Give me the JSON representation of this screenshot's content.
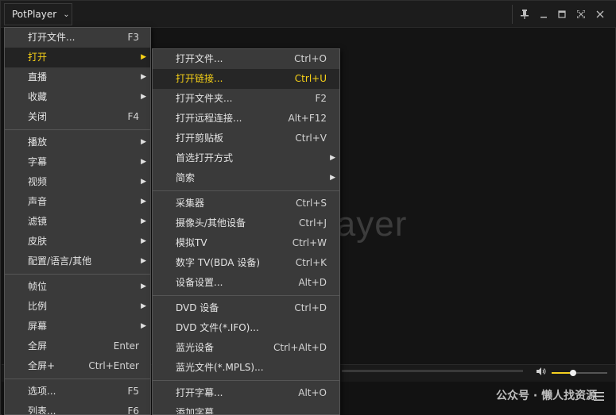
{
  "titlebar": {
    "app_name": "PotPlayer",
    "chevron_icon": "chevron-down-icon",
    "controls": [
      "pin-icon",
      "minimize-icon",
      "maximize-icon",
      "fullscreen-icon",
      "close-icon"
    ]
  },
  "video": {
    "logo_text": "layer"
  },
  "bottom": {
    "volume_level": 0.38,
    "watermark": "公众号 · 懒人找资源"
  },
  "main_menu": {
    "items": [
      {
        "label": "打开文件...",
        "shortcut": "F3",
        "submenu": false
      },
      {
        "label": "打开",
        "shortcut": "",
        "submenu": true,
        "active": true
      },
      {
        "label": "直播",
        "shortcut": "",
        "submenu": true
      },
      {
        "label": "收藏",
        "shortcut": "",
        "submenu": true
      },
      {
        "label": "关闭",
        "shortcut": "F4",
        "submenu": false
      },
      {
        "separator": true
      },
      {
        "label": "播放",
        "shortcut": "",
        "submenu": true
      },
      {
        "label": "字幕",
        "shortcut": "",
        "submenu": true
      },
      {
        "label": "视频",
        "shortcut": "",
        "submenu": true
      },
      {
        "label": "声音",
        "shortcut": "",
        "submenu": true
      },
      {
        "label": "滤镜",
        "shortcut": "",
        "submenu": true
      },
      {
        "label": "皮肤",
        "shortcut": "",
        "submenu": true
      },
      {
        "label": "配置/语言/其他",
        "shortcut": "",
        "submenu": true
      },
      {
        "separator": true
      },
      {
        "label": "帧位",
        "shortcut": "",
        "submenu": true
      },
      {
        "label": "比例",
        "shortcut": "",
        "submenu": true
      },
      {
        "label": "屏幕",
        "shortcut": "",
        "submenu": true
      },
      {
        "label": "全屏",
        "shortcut": "Enter",
        "submenu": false
      },
      {
        "label": "全屏+",
        "shortcut": "Ctrl+Enter",
        "submenu": false
      },
      {
        "separator": true
      },
      {
        "label": "选项...",
        "shortcut": "F5",
        "submenu": false
      },
      {
        "label": "列表...",
        "shortcut": "F6",
        "submenu": false
      }
    ]
  },
  "sub_menu": {
    "items": [
      {
        "label": "打开文件...",
        "shortcut": "Ctrl+O",
        "submenu": false
      },
      {
        "label": "打开链接...",
        "shortcut": "Ctrl+U",
        "submenu": false,
        "highlighted": true
      },
      {
        "label": "打开文件夹...",
        "shortcut": "F2",
        "submenu": false
      },
      {
        "label": "打开远程连接...",
        "shortcut": "Alt+F12",
        "submenu": false
      },
      {
        "label": "打开剪贴板",
        "shortcut": "Ctrl+V",
        "submenu": false
      },
      {
        "label": "首选打开方式",
        "shortcut": "",
        "submenu": true
      },
      {
        "label": "简索",
        "shortcut": "",
        "submenu": true
      },
      {
        "separator": true
      },
      {
        "label": "采集器",
        "shortcut": "Ctrl+S",
        "submenu": false
      },
      {
        "label": "摄像头/其他设备",
        "shortcut": "Ctrl+J",
        "submenu": false
      },
      {
        "label": "模拟TV",
        "shortcut": "Ctrl+W",
        "submenu": false
      },
      {
        "label": "数字 TV(BDA 设备)",
        "shortcut": "Ctrl+K",
        "submenu": false
      },
      {
        "label": "设备设置...",
        "shortcut": "Alt+D",
        "submenu": false
      },
      {
        "separator": true
      },
      {
        "label": "DVD 设备",
        "shortcut": "Ctrl+D",
        "submenu": false
      },
      {
        "label": "DVD 文件(*.IFO)...",
        "shortcut": "",
        "submenu": false
      },
      {
        "label": "蓝光设备",
        "shortcut": "Ctrl+Alt+D",
        "submenu": false
      },
      {
        "label": "蓝光文件(*.MPLS)...",
        "shortcut": "",
        "submenu": false
      },
      {
        "separator": true
      },
      {
        "label": "打开字幕...",
        "shortcut": "Alt+O",
        "submenu": false
      },
      {
        "label": "添加字幕...",
        "shortcut": "",
        "submenu": false
      }
    ]
  }
}
